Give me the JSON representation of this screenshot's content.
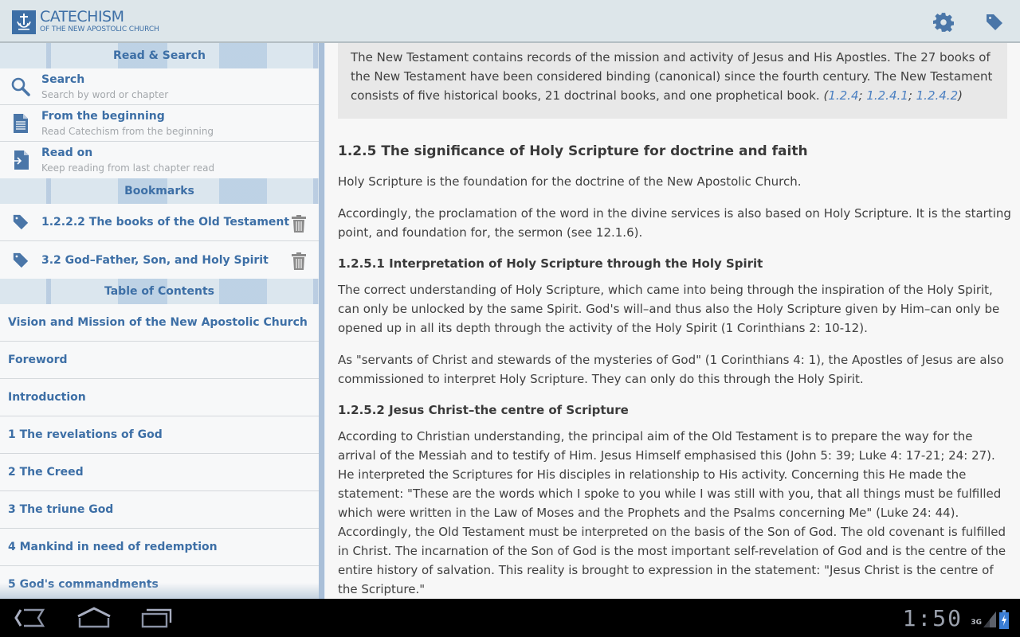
{
  "app": {
    "title": "CATECHISM",
    "subtitle": "OF THE NEW APOSTOLIC CHURCH",
    "brand_color": "#3d6fa6",
    "actions": [
      {
        "name": "settings",
        "icon": "gear-icon"
      },
      {
        "name": "bookmark",
        "icon": "tag-icon"
      }
    ]
  },
  "sidebar": {
    "read_search": {
      "header": "Read & Search",
      "items": [
        {
          "title": "Search",
          "subtitle": "Search by word or chapter",
          "icon": "search-icon"
        },
        {
          "title": "From the beginning",
          "subtitle": "Read Catechism from the beginning",
          "icon": "document-icon"
        },
        {
          "title": "Read on",
          "subtitle": "Keep reading from last chapter read",
          "icon": "document-enter-icon"
        }
      ]
    },
    "bookmarks": {
      "header": "Bookmarks",
      "items": [
        {
          "title": "1.2.2.2 The books of the Old Testament"
        },
        {
          "title": "3.2 God–Father, Son, and Holy Spirit"
        }
      ]
    },
    "toc": {
      "header": "Table of Contents",
      "items": [
        "Vision and Mission of the New Apostolic Church",
        "Foreword",
        "Introduction",
        "1 The revelations of God",
        "2 The Creed",
        "3 The triune God",
        "4 Mankind in need of redemption",
        "5 God's commandments"
      ]
    }
  },
  "content": {
    "summary": {
      "text": "The New Testament contains records of the mission and activity of Jesus and His Apostles. The 27 books of the New Testament have been considered binding (canonical) since the fourth century. The New Testament consists of five historical books, 21 doctrinal books, and one prophetical book. ",
      "refs": [
        "1.2.4",
        "1.2.4.1",
        "1.2.4.2"
      ]
    },
    "heading": "1.2.5 The significance of Holy Scripture for doctrine and faith",
    "p1": "Holy Scripture is the foundation for the doctrine of the New Apostolic Church.",
    "p2": "Accordingly, the proclamation of the word in the divine services is also based on Holy Scripture. It is the starting point, and foundation for, the sermon (see 12.1.6).",
    "sub1": "1.2.5.1 Interpretation of Holy Scripture through the Holy Spirit",
    "p3": "The correct understanding of Holy Scripture, which came into being through the inspiration of the Holy Spirit, can only be unlocked by the same Spirit. God's will–and thus also the Holy Scripture given by Him–can only be opened up in all its depth through the activity of the Holy Spirit (1 Corinthians 2: 10-12).",
    "p4": "As \"servants of Christ and stewards of the mysteries of God\" (1 Corinthians 4: 1), the Apostles of Jesus are also commissioned to interpret Holy Scripture. They can only do this through the Holy Spirit.",
    "sub2": "1.2.5.2 Jesus Christ–the centre of Scripture",
    "p5": "According to Christian understanding, the principal aim of the Old Testament is to prepare the way for the arrival of the Messiah and to testify of Him. Jesus Himself emphasised this (John 5: 39; Luke 4: 17-21; 24: 27). He interpreted the Scriptures for His disciples in relationship to His activity. Concerning this He made the statement: \"These are the words which I spoke to you while I was still with you, that all things must be fulfilled which were written in the Law of Moses and the Prophets and the Psalms concerning Me\" (Luke 24: 44). Accordingly, the Old Testament must be interpreted on the basis of the Son of God. The old covenant is fulfilled in Christ. The incarnation of the Son of God is the most important self-revelation of God and is the centre of the entire history of salvation. This reality is brought to expression in the statement: \"Jesus Christ is the centre of the Scripture.\""
  },
  "system_bar": {
    "time": "1:50",
    "network": "3G",
    "battery": "charging"
  }
}
